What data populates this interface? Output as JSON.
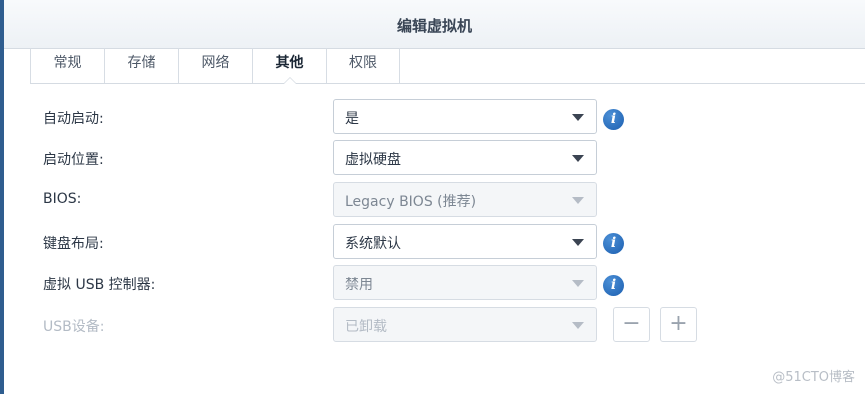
{
  "window": {
    "title": "编辑虚拟机"
  },
  "tabs": [
    {
      "label": "常规",
      "active": false
    },
    {
      "label": "存储",
      "active": false
    },
    {
      "label": "网络",
      "active": false
    },
    {
      "label": "其他",
      "active": true
    },
    {
      "label": "权限",
      "active": false
    }
  ],
  "form": {
    "autostart": {
      "label": "自动启动:",
      "value": "是"
    },
    "boot_from": {
      "label": "启动位置:",
      "value": "虚拟硬盘"
    },
    "bios": {
      "label": "BIOS:",
      "value": "Legacy BIOS (推荐)"
    },
    "keyboard": {
      "label": "键盘布局:",
      "value": "系统默认"
    },
    "usb_controller": {
      "label": "虚拟 USB 控制器:",
      "value": "禁用"
    },
    "usb_device": {
      "label": "USB设备:",
      "value": "已卸载"
    }
  },
  "icons": {
    "info": "i",
    "minus": "−",
    "plus": "+"
  },
  "watermark": "@51CTO博客",
  "colors": {
    "info_blue": "#1c5fb0",
    "frame_blue": "#2f5d8f"
  }
}
